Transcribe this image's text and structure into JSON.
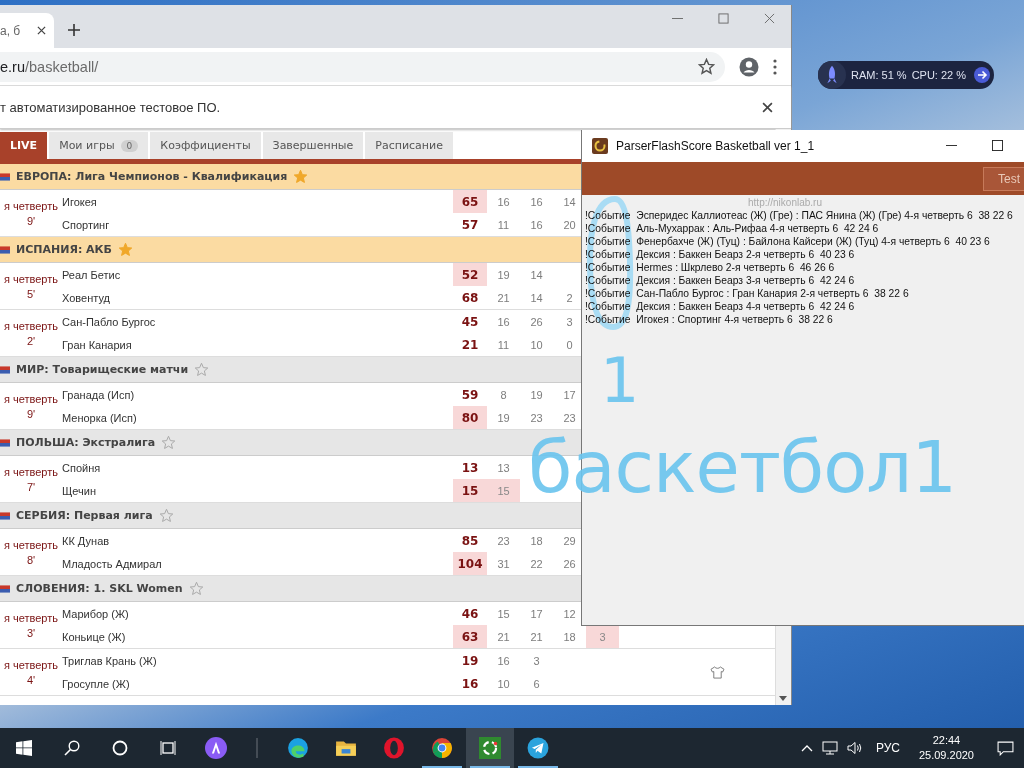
{
  "browser": {
    "tab": {
      "title": "а, б"
    },
    "address": {
      "host": "e.ru",
      "path": "/basketball/"
    },
    "infobar": {
      "text": "т автоматизированное тестовое ПО."
    },
    "nav_tabs": [
      {
        "label": "LIVE",
        "selected": true
      },
      {
        "label": "Мои игры",
        "badge": "0",
        "selected": false
      },
      {
        "label": "Коэффициенты",
        "selected": false
      },
      {
        "label": "Завершенные",
        "selected": false
      },
      {
        "label": "Расписание",
        "selected": false
      }
    ],
    "leagues": [
      {
        "name": "ЕВРОПА: Лига Чемпионов - Квалификация",
        "favorite": true,
        "matches": [
          {
            "stage": "я четверть",
            "minute": "9'",
            "lineup_icon": false,
            "teams": [
              {
                "name": "Игокея",
                "score": "65",
                "leading": true,
                "periods": [
                  {
                    "value": "16",
                    "highlighted": false
                  },
                  {
                    "value": "16",
                    "highlighted": false
                  },
                  {
                    "value": "14",
                    "highlighted": false
                  }
                ]
              },
              {
                "name": "Спортинг",
                "score": "57",
                "leading": false,
                "periods": [
                  {
                    "value": "11",
                    "highlighted": false
                  },
                  {
                    "value": "16",
                    "highlighted": false
                  },
                  {
                    "value": "20",
                    "highlighted": false
                  }
                ]
              }
            ]
          }
        ]
      },
      {
        "name": "ИСПАНИЯ: АКБ",
        "favorite": true,
        "matches": [
          {
            "stage": "я четверть",
            "minute": "5'",
            "lineup_icon": false,
            "teams": [
              {
                "name": "Реал Бетис",
                "score": "52",
                "leading": true,
                "periods": [
                  {
                    "value": "19",
                    "highlighted": false
                  },
                  {
                    "value": "14",
                    "highlighted": false
                  }
                ]
              },
              {
                "name": "Ховентуд",
                "score": "68",
                "leading": false,
                "periods": [
                  {
                    "value": "21",
                    "highlighted": false
                  },
                  {
                    "value": "14",
                    "highlighted": false
                  },
                  {
                    "value": "2",
                    "highlighted": false
                  }
                ]
              }
            ]
          },
          {
            "stage": "я четверть",
            "minute": "2'",
            "lineup_icon": false,
            "teams": [
              {
                "name": "Сан-Пабло Бургос",
                "score": "45",
                "leading": false,
                "periods": [
                  {
                    "value": "16",
                    "highlighted": false
                  },
                  {
                    "value": "26",
                    "highlighted": false
                  },
                  {
                    "value": "3",
                    "highlighted": false
                  }
                ]
              },
              {
                "name": "Гран Канария",
                "score": "21",
                "leading": false,
                "periods": [
                  {
                    "value": "11",
                    "highlighted": false
                  },
                  {
                    "value": "10",
                    "highlighted": false
                  },
                  {
                    "value": "0",
                    "highlighted": false
                  }
                ]
              }
            ]
          }
        ]
      },
      {
        "name": "МИР: Товарищеские матчи",
        "favorite": false,
        "matches": [
          {
            "stage": "я четверть",
            "minute": "9'",
            "lineup_icon": false,
            "teams": [
              {
                "name": "Гранада (Исп)",
                "score": "59",
                "leading": false,
                "periods": [
                  {
                    "value": "8",
                    "highlighted": false
                  },
                  {
                    "value": "19",
                    "highlighted": false
                  },
                  {
                    "value": "17",
                    "highlighted": false
                  }
                ]
              },
              {
                "name": "Менорка (Исп)",
                "score": "80",
                "leading": true,
                "periods": [
                  {
                    "value": "19",
                    "highlighted": false
                  },
                  {
                    "value": "23",
                    "highlighted": false
                  },
                  {
                    "value": "23",
                    "highlighted": false
                  }
                ]
              }
            ]
          }
        ]
      },
      {
        "name": "ПОЛЬША: Экстралига",
        "favorite": false,
        "matches": [
          {
            "stage": "я четверть",
            "minute": "7'",
            "lineup_icon": false,
            "teams": [
              {
                "name": "Спойня",
                "score": "13",
                "leading": false,
                "periods": [
                  {
                    "value": "13",
                    "highlighted": false
                  }
                ]
              },
              {
                "name": "Щечин",
                "score": "15",
                "leading": true,
                "periods": [
                  {
                    "value": "15",
                    "highlighted": true
                  }
                ]
              }
            ]
          }
        ]
      },
      {
        "name": "СЕРБИЯ: Первая лига",
        "favorite": false,
        "matches": [
          {
            "stage": "я четверть",
            "minute": "8'",
            "lineup_icon": false,
            "teams": [
              {
                "name": "КК Дунав",
                "score": "85",
                "leading": false,
                "periods": [
                  {
                    "value": "23",
                    "highlighted": false
                  },
                  {
                    "value": "18",
                    "highlighted": false
                  },
                  {
                    "value": "29",
                    "highlighted": false
                  }
                ]
              },
              {
                "name": "Младость Адмирал",
                "score": "104",
                "leading": true,
                "periods": [
                  {
                    "value": "31",
                    "highlighted": false
                  },
                  {
                    "value": "22",
                    "highlighted": false
                  },
                  {
                    "value": "26",
                    "highlighted": false
                  }
                ]
              }
            ]
          }
        ]
      },
      {
        "name": "СЛОВЕНИЯ: 1. SKL Women",
        "favorite": false,
        "matches": [
          {
            "stage": "я четверть",
            "minute": "3'",
            "lineup_icon": false,
            "teams": [
              {
                "name": "Марибор (Ж)",
                "score": "46",
                "leading": false,
                "periods": [
                  {
                    "value": "15",
                    "highlighted": false
                  },
                  {
                    "value": "17",
                    "highlighted": false
                  },
                  {
                    "value": "12",
                    "highlighted": false
                  }
                ]
              },
              {
                "name": "Коньице (Ж)",
                "score": "63",
                "leading": true,
                "periods": [
                  {
                    "value": "21",
                    "highlighted": false
                  },
                  {
                    "value": "21",
                    "highlighted": false
                  },
                  {
                    "value": "18",
                    "highlighted": false
                  },
                  {
                    "value": "3",
                    "highlighted": true
                  }
                ]
              }
            ]
          },
          {
            "stage": "я четверть",
            "minute": "4'",
            "lineup_icon": true,
            "teams": [
              {
                "name": "Триглав Крань (Ж)",
                "score": "19",
                "leading": false,
                "periods": [
                  {
                    "value": "16",
                    "highlighted": false
                  },
                  {
                    "value": "3",
                    "highlighted": false
                  }
                ]
              },
              {
                "name": "Гросупле (Ж)",
                "score": "16",
                "leading": false,
                "periods": [
                  {
                    "value": "10",
                    "highlighted": false
                  },
                  {
                    "value": "6",
                    "highlighted": false
                  }
                ]
              }
            ]
          }
        ]
      }
    ]
  },
  "parser": {
    "title": "ParserFlashScore Basketball ver 1_1",
    "toolbar_button": "Test",
    "link": "http://nikonlab.ru",
    "log": [
      "!Событие  Эсперидес Каллиотеас (Ж) (Гре) : ПАС Янина (Ж) (Гре) 4-я четверть 6  38 22 6",
      "!Событие  Аль-Мухаррак : Аль-Рифаа 4-я четверть 6  42 24 6",
      "!Событие  Фенербахче (Ж) (Туц) : Байлона Кайсери (Ж) (Туц) 4-я четверть 6  40 23 6",
      "!Событие  Дексия : Баккен Беарз 2-я четверть 6  40 23 6",
      "!Событие  Hermes : Шкрлево 2-я четверть 6  46 26 6",
      "!Событие  Дексия : Баккен Беарз 3-я четверть 6  42 24 6",
      "!Событие  Сан-Пабло Бургос : Гран Канария 2-я четверть 6  38 22 6",
      "!Событие  Дексия : Баккен Беарз 4-я четверть 6  42 24 6",
      "!Событие  Игокея : Спортинг 4-я четверть 6  38 22 6"
    ]
  },
  "widget": {
    "ram": "RAM: 51 %",
    "cpu": "CPU: 22 %"
  },
  "annotation": {
    "one": "1",
    "word": "баскетбол1"
  },
  "taskbar": {
    "buttons": [
      {
        "kind": "start"
      },
      {
        "kind": "search"
      },
      {
        "kind": "cortana"
      },
      {
        "kind": "taskview"
      },
      {
        "kind": "alice"
      }
    ],
    "apps": [
      {
        "kind": "edge",
        "running": false,
        "selected": false
      },
      {
        "kind": "folder",
        "running": false,
        "selected": false
      },
      {
        "kind": "opera",
        "running": false,
        "selected": false
      },
      {
        "kind": "chrome",
        "running": true,
        "selected": false
      },
      {
        "kind": "parser",
        "running": true,
        "selected": true
      },
      {
        "kind": "telegram",
        "running": true,
        "selected": false
      }
    ],
    "tray": [
      {
        "kind": "chevron"
      },
      {
        "kind": "network"
      },
      {
        "kind": "volume"
      }
    ],
    "language": "РУС",
    "time": "22:44",
    "date": "25.09.2020"
  }
}
